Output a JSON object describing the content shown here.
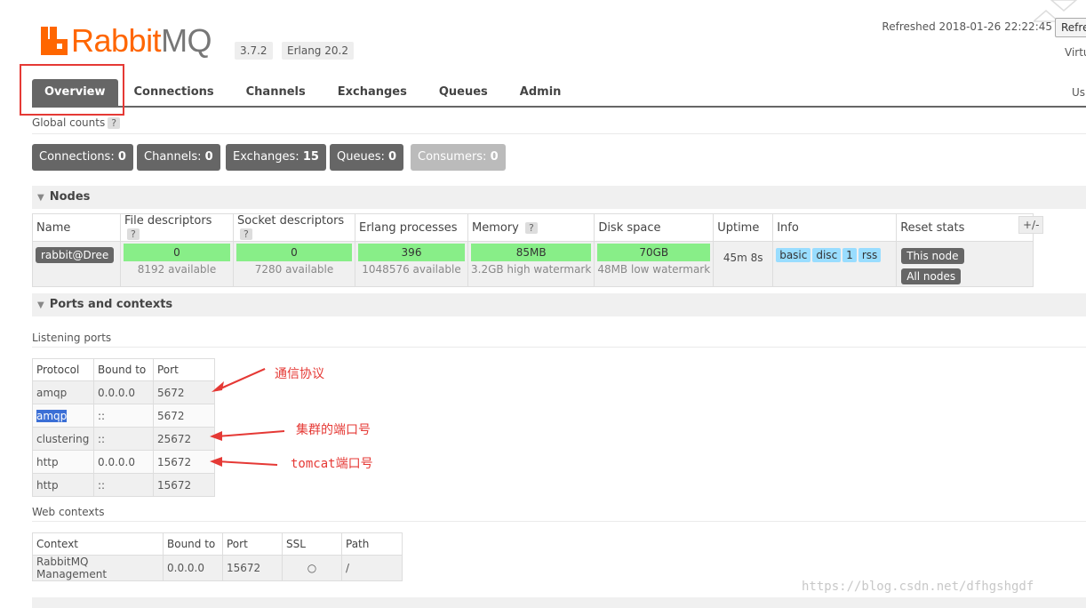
{
  "header": {
    "logo_text_main": "Rabbit",
    "logo_text_mq": "MQ",
    "version": "3.7.2",
    "erlang": "Erlang 20.2",
    "refreshed": "Refreshed 2018-01-26 22:22:45",
    "refresh_button": "Refre",
    "virtual_host_label": "Virtu",
    "user_label": "Us"
  },
  "nav": {
    "tabs": [
      {
        "label": "Overview",
        "active": true
      },
      {
        "label": "Connections"
      },
      {
        "label": "Channels"
      },
      {
        "label": "Exchanges"
      },
      {
        "label": "Queues"
      },
      {
        "label": "Admin"
      }
    ]
  },
  "global_counts": {
    "label": "Global counts",
    "help": "?",
    "items": [
      {
        "label": "Connections:",
        "value": "0"
      },
      {
        "label": "Channels:",
        "value": "0"
      },
      {
        "label": "Exchanges:",
        "value": "15"
      },
      {
        "label": "Queues:",
        "value": "0"
      },
      {
        "label": "Consumers:",
        "value": "0"
      }
    ]
  },
  "nodes": {
    "title": "Nodes",
    "plus_minus": "+/-",
    "headers": {
      "name": "Name",
      "fd": "File descriptors",
      "sd": "Socket descriptors",
      "ep": "Erlang processes",
      "mem": "Memory",
      "disk": "Disk space",
      "uptime": "Uptime",
      "info": "Info",
      "reset": "Reset stats",
      "help": "?"
    },
    "row": {
      "name": "rabbit@Dree",
      "fd_used": "0",
      "fd_avail": "8192 available",
      "sd_used": "0",
      "sd_avail": "7280 available",
      "ep_used": "396",
      "ep_avail": "1048576 available",
      "mem_used": "85MB",
      "mem_sub": "3.2GB high watermark",
      "disk_used": "70GB",
      "disk_sub": "48MB low watermark",
      "uptime": "45m 8s",
      "info": [
        "basic",
        "disc",
        "1",
        "rss"
      ],
      "reset_this": "This node",
      "reset_all": "All nodes"
    }
  },
  "ports": {
    "title": "Ports and contexts",
    "listening_label": "Listening ports",
    "headers": [
      "Protocol",
      "Bound to",
      "Port"
    ],
    "rows": [
      [
        "amqp",
        "0.0.0.0",
        "5672"
      ],
      [
        "amqp",
        "::",
        "5672"
      ],
      [
        "clustering",
        "::",
        "25672"
      ],
      [
        "http",
        "0.0.0.0",
        "15672"
      ],
      [
        "http",
        "::",
        "15672"
      ]
    ],
    "web_label": "Web contexts",
    "web_headers": [
      "Context",
      "Bound to",
      "Port",
      "SSL",
      "Path"
    ],
    "web_rows": [
      [
        "RabbitMQ Management",
        "0.0.0.0",
        "15672",
        "○",
        "/"
      ]
    ]
  },
  "annotations": {
    "protocol": "通信协议",
    "cluster": "集群的端口号",
    "tomcat_prefix": "tomcat",
    "tomcat_suffix": "端口号"
  },
  "watermark": "https://blog.csdn.net/dfhgshgdf",
  "colors": {
    "brand": "#ff6600",
    "dark": "#666666",
    "bar_green": "#88ee88",
    "info_blue": "#99ddff",
    "annotation_red": "#e53935"
  }
}
